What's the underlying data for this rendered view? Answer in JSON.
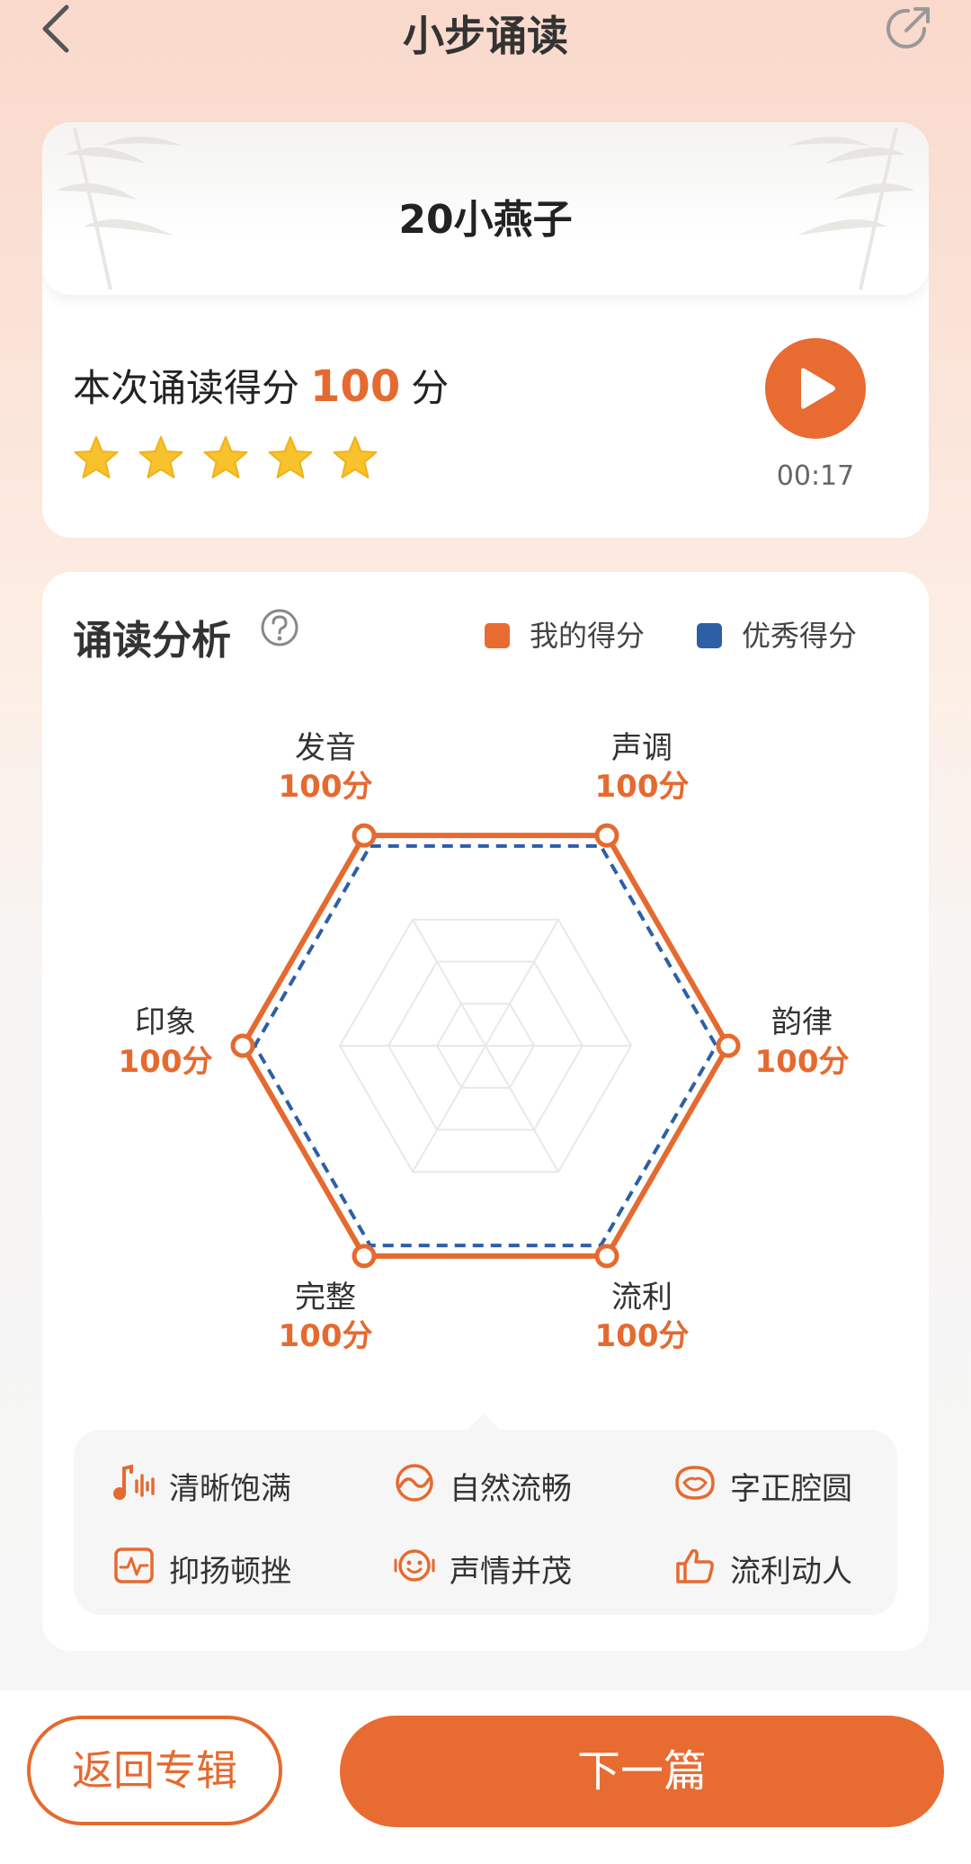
{
  "header": {
    "title": "小步诵读"
  },
  "song": {
    "title": "20小燕子"
  },
  "score": {
    "prefix": "本次诵读得分",
    "value": "100",
    "unit": "分",
    "stars": 5
  },
  "player": {
    "duration": "00:17"
  },
  "analysis": {
    "title": "诵读分析",
    "legend_mine": "我的得分",
    "legend_excellent": "优秀得分"
  },
  "chart_data": {
    "type": "radar",
    "categories": [
      "发音",
      "声调",
      "韵律",
      "流利",
      "完整",
      "印象"
    ],
    "series": [
      {
        "name": "我的得分",
        "values": [
          100,
          100,
          100,
          100,
          100,
          100
        ]
      },
      {
        "name": "优秀得分",
        "values": [
          95,
          95,
          95,
          95,
          95,
          95
        ]
      }
    ],
    "value_labels": [
      "100分",
      "100分",
      "100分",
      "100分",
      "100分",
      "100分"
    ],
    "max": 100
  },
  "tags": [
    {
      "label": "清晰饱满",
      "icon": "music-note-icon"
    },
    {
      "label": "自然流畅",
      "icon": "wave-circle-icon"
    },
    {
      "label": "字正腔圆",
      "icon": "mouth-icon"
    },
    {
      "label": "抑扬顿挫",
      "icon": "pulse-icon"
    },
    {
      "label": "声情并茂",
      "icon": "smile-icon"
    },
    {
      "label": "流利动人",
      "icon": "thumbs-up-icon"
    }
  ],
  "buttons": {
    "back_album": "返回专辑",
    "next": "下一篇"
  },
  "colors": {
    "accent": "#e86b32",
    "excellent": "#2d5fa6"
  }
}
